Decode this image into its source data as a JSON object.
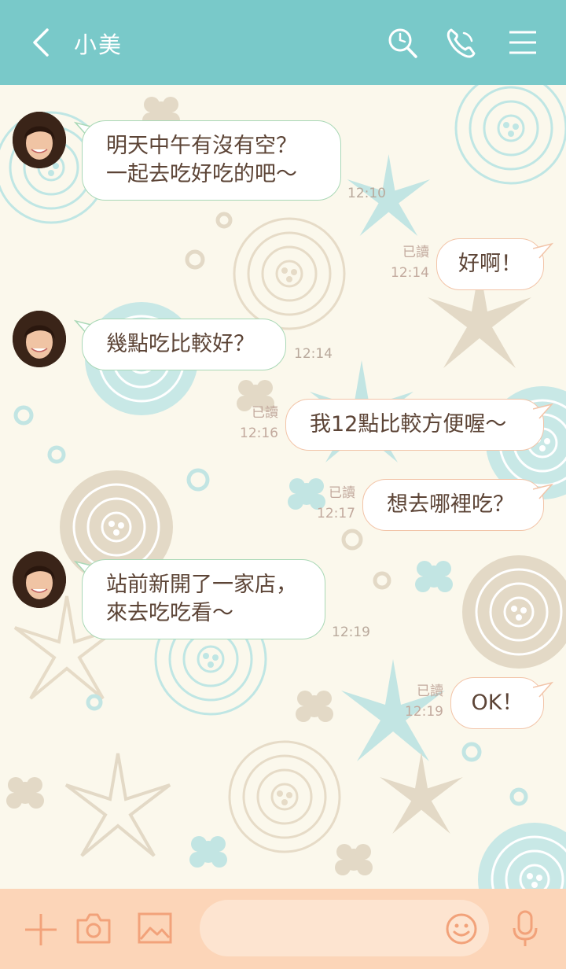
{
  "header": {
    "title": "小美",
    "background": "#79c9c9",
    "icons": [
      "back-icon",
      "search-icon",
      "phone-icon",
      "menu-icon"
    ]
  },
  "messages": [
    {
      "side": "in",
      "lines": [
        "明天中午有沒有空？",
        "一起去吃好吃的吧～"
      ],
      "time": "12:10"
    },
    {
      "side": "out",
      "lines": [
        "好啊！"
      ],
      "read": "已讀",
      "time": "12:14"
    },
    {
      "side": "in",
      "lines": [
        "幾點吃比較好？"
      ],
      "time": "12:14"
    },
    {
      "side": "out",
      "lines": [
        "我12點比較方便喔～"
      ],
      "read": "已讀",
      "time": "12:16"
    },
    {
      "side": "out",
      "lines": [
        "想去哪裡吃？"
      ],
      "read": "已讀",
      "time": "12:17"
    },
    {
      "side": "in",
      "lines": [
        "站前新開了一家店，",
        "來去吃吃看～"
      ],
      "time": "12:19"
    },
    {
      "side": "out",
      "lines": [
        "OK！"
      ],
      "read": "已讀",
      "time": "12:19"
    }
  ],
  "footer": {
    "icons": [
      "plus-icon",
      "camera-icon",
      "image-icon",
      "emoji-icon",
      "microphone-icon"
    ],
    "input_value": "",
    "background": "#fcd5b8",
    "accent": "#f2a27a"
  }
}
